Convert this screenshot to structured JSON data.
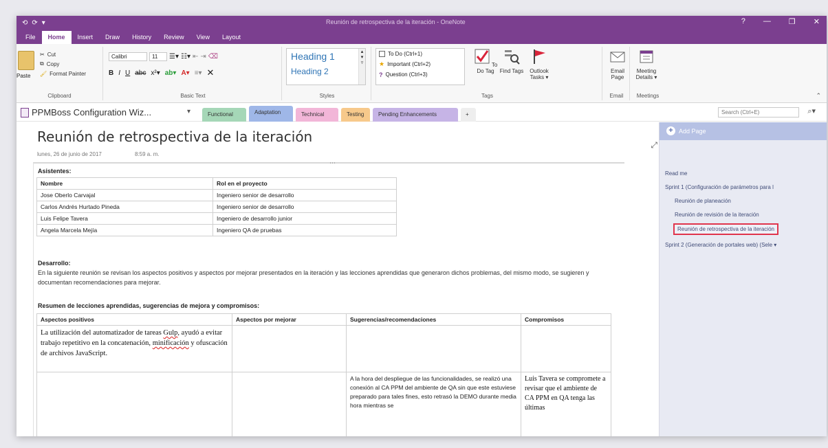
{
  "window": {
    "qat": [
      "⟲",
      "⟳",
      "▾"
    ],
    "title": "Reunión de retrospectiva de la iteración - OneNote",
    "title_meta": "",
    "user": "",
    "controls": [
      "?",
      "—",
      "❐",
      "✕"
    ]
  },
  "ribbon_tabs": [
    "File",
    "Home",
    "Insert",
    "Draw",
    "History",
    "Review",
    "View",
    "Layout"
  ],
  "ribbon": {
    "clipboard": {
      "paste": "Paste",
      "cut": "Cut",
      "copy": "Copy",
      "format_painter": "Format Painter",
      "label": "Clipboard"
    },
    "basic_text": {
      "font": "Calibri",
      "size": "11",
      "label": "Basic Text"
    },
    "styles": {
      "h1": "Heading 1",
      "h2": "Heading 2",
      "label": "Styles"
    },
    "tags": {
      "todo": "To Do (Ctrl+1)",
      "important": "Important (Ctrl+2)",
      "question": "Question (Ctrl+3)",
      "label": "Tags"
    },
    "todo_tag": "To Do Tag",
    "find_tags": "Find Tags",
    "outlook_tasks": "Outlook Tasks ▾",
    "email_page": "Email Page",
    "meeting_details": "Meeting Details ▾",
    "email_label": "Email",
    "meetings_label": "Meetings"
  },
  "notebook": {
    "title": "PPMBoss Configuration Wiz...",
    "sections": [
      {
        "label": "Functional",
        "color": "#a5d7b7"
      },
      {
        "label": "Adaptation",
        "color": "#9fb7e8"
      },
      {
        "label": "Technical",
        "color": "#f2b6d8"
      },
      {
        "label": "Testing",
        "color": "#f7c98b"
      },
      {
        "label": "Pending Enhancements",
        "color": "#c6b4e6"
      },
      {
        "label": "+",
        "color": "#eeeeee"
      }
    ],
    "search_placeholder": "Search (Ctrl+E)"
  },
  "page": {
    "title": "Reunión de retrospectiva de la iteración",
    "date": "lunes, 26 de junio de 2017",
    "time": "8:59 a. m.",
    "attendees_heading": "Asistentes:",
    "attendees": {
      "headers": [
        "Nombre",
        "Rol en el proyecto"
      ],
      "rows": [
        [
          "Jose Oberlo Carvajal",
          "Ingeniero senior de desarrollo"
        ],
        [
          "Carlos Andrés Hurtado Pineda",
          "Ingeniero senior de desarrollo"
        ],
        [
          "Luis Felipe Tavera",
          "Ingeniero de desarrollo junior"
        ],
        [
          "Angela Marcela Mejía",
          "Ingeniero QA de pruebas"
        ]
      ]
    },
    "development_heading": "Desarrollo:",
    "development_text": "En la siguiente reunión se revisan los aspectos positivos y aspectos por mejorar presentados en la iteración y las lecciones aprendidas que generaron dichos problemas, del mismo modo, se sugieren y documentan recomendaciones para mejorar.",
    "lessons_heading": "Resumen de lecciones aprendidas, sugerencias de mejora y compromisos:",
    "lessons": {
      "headers": [
        "Aspectos positivos",
        "Aspectos por mejorar",
        "Sugerencias/recomendaciones",
        "Compromisos"
      ],
      "row1_positive_a": "La utilización del automatizador de tareas ",
      "row1_positive_gulp": "Gulp",
      "row1_positive_b": ", ayudó a evitar trabajo repetitivo en la concatenación, ",
      "row1_positive_min": "minificación",
      "row1_positive_c": " y ofuscación de archivos JavaScript.",
      "row2_suggestion": "A la hora del despliegue de las funcionalidades, se realizó una conexión al CA PPM del ambiente de QA sin que este estuviese preparado para tales fines, esto retrasó la DEMO durante media hora mientras se",
      "row2_commitment": "Luis Tavera se compromete a revisar que el ambiente de CA PPM en QA tenga las últimas"
    }
  },
  "pages_pane": {
    "add_page": "Add Page",
    "items": [
      {
        "label": "Read me",
        "indent": 0,
        "selected": false
      },
      {
        "label": "Sprint 1 (Configuración de parámetros para l",
        "indent": 0,
        "selected": false
      },
      {
        "label": "Reunión de planeación",
        "indent": 1,
        "selected": false
      },
      {
        "label": "Reunión de revisión de la iteración",
        "indent": 1,
        "selected": false
      },
      {
        "label": "Reunión de retrospectiva de la iteración",
        "indent": 1,
        "selected": true
      },
      {
        "label": "Sprint 2 (Generación de portales web) (Sele ▾",
        "indent": 0,
        "selected": false
      }
    ]
  }
}
